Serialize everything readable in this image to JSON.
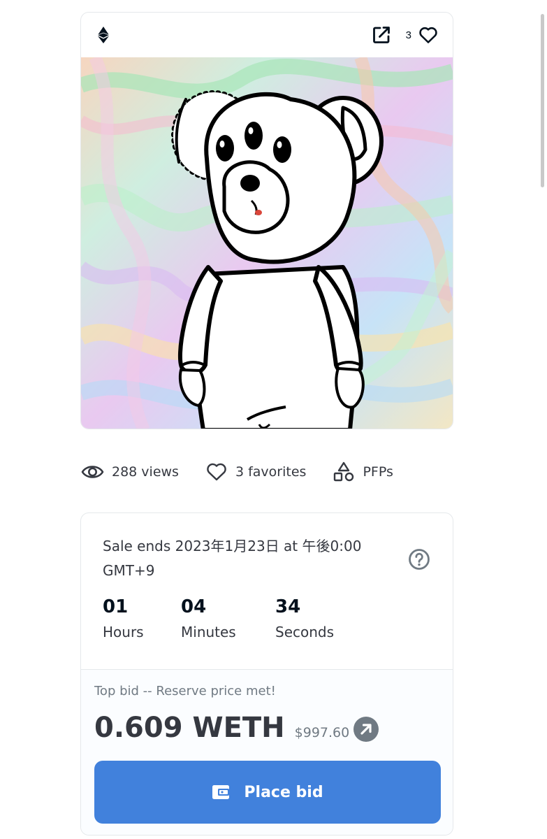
{
  "header": {
    "favorite_count": "3"
  },
  "stats": {
    "views": "288 views",
    "favorites": "3 favorites",
    "category": "PFPs"
  },
  "sale": {
    "ends_text": "Sale ends 2023年1月23日 at 午後0:00 GMT+9",
    "countdown": [
      {
        "value": "01",
        "label": "Hours"
      },
      {
        "value": "04",
        "label": "Minutes"
      },
      {
        "value": "34",
        "label": "Seconds"
      }
    ],
    "top_bid_label": "Top bid -- Reserve price met!",
    "price": "0.609 WETH",
    "price_usd": "$997.60",
    "place_bid_label": "Place bid"
  },
  "icons": [
    "ethereum-icon",
    "external-link-icon",
    "heart-icon",
    "eye-icon",
    "shapes-icon",
    "help-icon",
    "arrow-up-right-icon",
    "wallet-icon"
  ],
  "colors": {
    "accent": "#4181dc",
    "text_primary": "#353840",
    "text_secondary": "#707a83",
    "border": "#e5e8eb"
  }
}
